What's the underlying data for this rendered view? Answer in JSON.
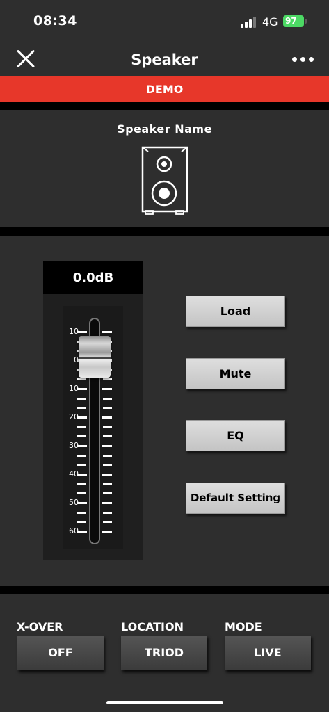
{
  "status_bar": {
    "time": "08:34",
    "network": "4G",
    "battery": "97"
  },
  "nav": {
    "title": "Speaker"
  },
  "banner": {
    "label": "DEMO"
  },
  "speaker": {
    "name": "Speaker Name"
  },
  "fader": {
    "display": "0.0dB",
    "scale": [
      "10",
      "0",
      "10",
      "20",
      "30",
      "40",
      "50",
      "60"
    ]
  },
  "actions": {
    "load": "Load",
    "mute": "Mute",
    "eq": "EQ",
    "default_setting": "Default Setting"
  },
  "bottom": {
    "xover": {
      "label": "X-OVER",
      "value": "OFF"
    },
    "location": {
      "label": "LOCATION",
      "value": "TRIOD"
    },
    "mode": {
      "label": "MODE",
      "value": "LIVE"
    }
  },
  "colors": {
    "banner": "#e7372a",
    "background": "#2e2e2e",
    "battery": "#4cd964"
  }
}
